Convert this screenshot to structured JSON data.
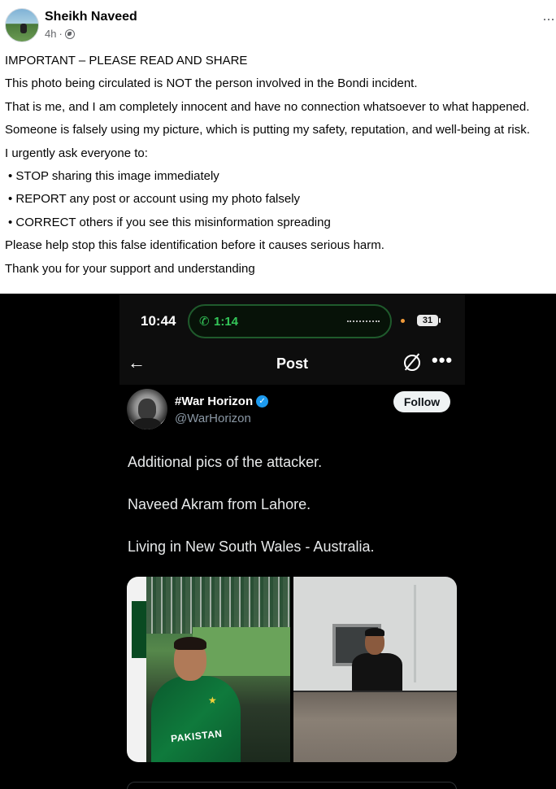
{
  "post": {
    "author": "Sheikh Naveed",
    "time": "4h",
    "separator": "·",
    "more": "···",
    "lines": [
      "IMPORTANT – PLEASE READ AND SHARE",
      "This photo being circulated is NOT the person involved in the Bondi incident.",
      "That is me, and I am completely innocent and have no connection whatsoever to what happened.",
      "Someone is falsely using my picture, which is putting my safety, reputation, and well-being at risk.",
      "I urgently ask everyone to:",
      "• STOP sharing this image immediately",
      "• REPORT any post or account using my photo falsely",
      "• CORRECT others if you see this misinformation spreading",
      "Please help stop this false identification before it causes serious harm.",
      "Thank you for your support and understanding"
    ]
  },
  "screenshot": {
    "status_bar": {
      "time": "10:44",
      "call_duration": "1:14",
      "battery": "31"
    },
    "nav": {
      "back": "←",
      "title": "Post",
      "more": "•••"
    },
    "tweet": {
      "display_name": "#War Horizon",
      "verified_mark": "✓",
      "handle": "@WarHorizon",
      "follow_label": "Follow",
      "text": [
        "Additional pics of the attacker.",
        "Naveed Akram from Lahore.",
        "Living in New South Wales - Australia."
      ],
      "jersey_text": "PAKISTAN"
    }
  },
  "icons": {
    "globe": "globe-icon",
    "phone": "phone-icon",
    "grok": "grok-icon",
    "verified": "verified-icon",
    "back": "back-arrow-icon",
    "more": "more-icon"
  },
  "colors": {
    "fb_text": "#050505",
    "fb_meta": "#65676b",
    "x_background": "#000000",
    "call_green": "#34c759",
    "verified_blue": "#1d9bf0",
    "handle_gray": "#8b98a5"
  }
}
